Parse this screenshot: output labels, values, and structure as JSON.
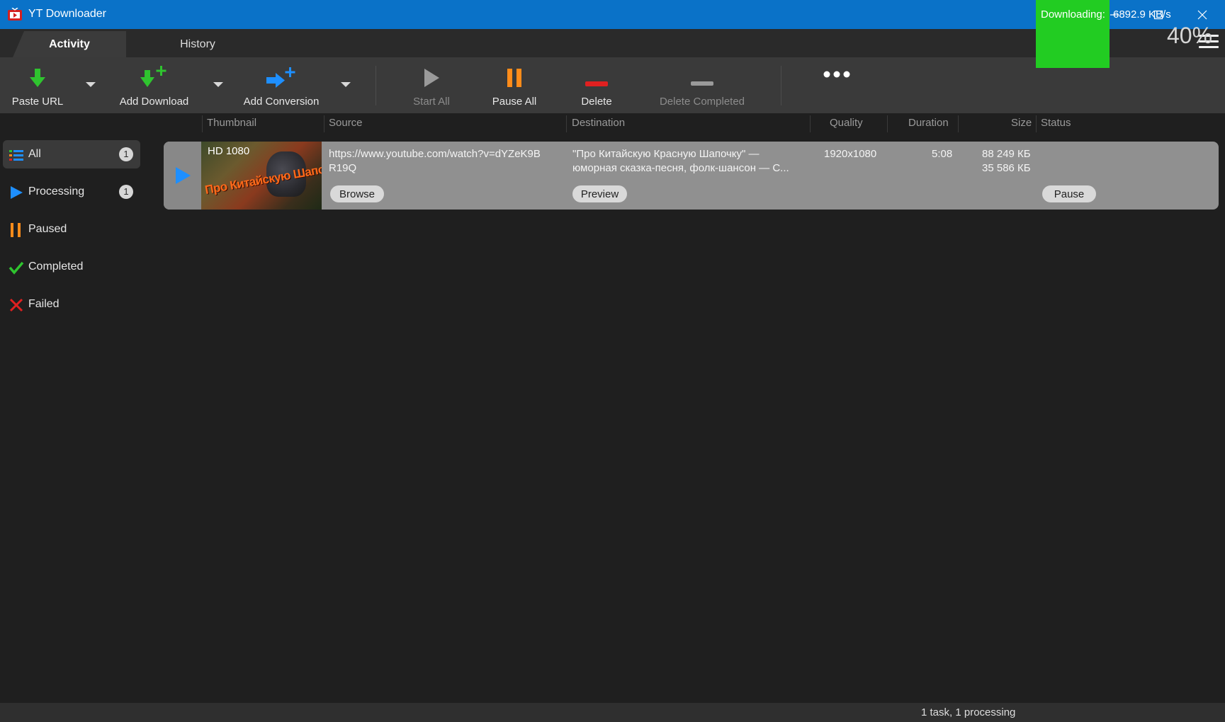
{
  "window": {
    "title": "YT Downloader",
    "accent_color": "#0a72c8"
  },
  "tabs": [
    {
      "label": "Activity",
      "selected": true
    },
    {
      "label": "History",
      "selected": false
    }
  ],
  "toolbar": {
    "paste_url": "Paste URL",
    "add_download": "Add Download",
    "add_conversion": "Add Conversion",
    "start_all": "Start All",
    "pause_all": "Pause All",
    "delete": "Delete",
    "delete_completed": "Delete Completed",
    "more_icon": "more-icon"
  },
  "sidebar": {
    "items": [
      {
        "label": "All",
        "count": "1",
        "icon": "list-icon",
        "selected": true
      },
      {
        "label": "Processing",
        "count": "1",
        "icon": "play-icon"
      },
      {
        "label": "Paused",
        "icon": "pause-icon"
      },
      {
        "label": "Completed",
        "icon": "check-icon"
      },
      {
        "label": "Failed",
        "icon": "x-icon"
      }
    ]
  },
  "columns": {
    "thumbnail": "Thumbnail",
    "source": "Source",
    "destination": "Destination",
    "quality": "Quality",
    "duration": "Duration",
    "size": "Size",
    "status": "Status"
  },
  "downloads": [
    {
      "thumbnail_badge": "HD 1080",
      "thumbnail_caption": "Про Китайскую Шапочку",
      "source_line1": "https://www.youtube.com/watch?v=dYZeK9B",
      "source_line2": "R19Q",
      "browse_label": "Browse",
      "destination_line1": "\"Про Китайскую Красную Шапочку\" —",
      "destination_line2": "юморная сказка-песня, фолк-шансон — С...",
      "preview_label": "Preview",
      "quality": "1920x1080",
      "duration": "5:08",
      "size_total": "88 249 КБ",
      "size_downloaded": "35 586 КБ",
      "status": "Downloading:",
      "speed": "6892.9 KB/s",
      "pause_label": "Pause",
      "percent": "40%",
      "status_color": "#22cc22"
    }
  ],
  "statusbar": {
    "summary": "1 task, 1 processing"
  }
}
